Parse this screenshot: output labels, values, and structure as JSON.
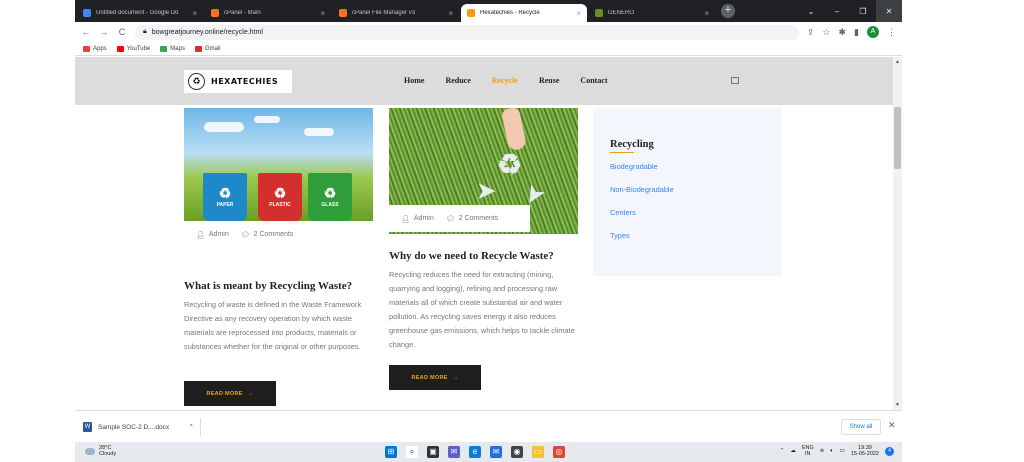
{
  "browser": {
    "tabs": [
      {
        "label": "Untitled document - Google Do",
        "favicon_color": "#4285f4",
        "active": false
      },
      {
        "label": "cPanel - Main",
        "favicon_color": "#ff6c2c",
        "active": false
      },
      {
        "label": "cPanel File Manager v3",
        "favicon_color": "#ff6c2c",
        "active": false
      },
      {
        "label": "Hexatechies - Recycle",
        "favicon_color": "#f39c12",
        "active": true
      },
      {
        "label": "GENERO",
        "favicon_color": "#6b8e23",
        "active": false
      }
    ],
    "new_tab_symbol": "+",
    "window_controls": {
      "chevron": "⌄",
      "minimize": "–",
      "maximize": "❐",
      "close": "✕"
    },
    "url": "bowgreatjourney.online/recycle.html",
    "nav": {
      "back": "←",
      "forward": "→",
      "reload": "C"
    },
    "profile_initial": "A",
    "bookmarks": [
      {
        "label": "Apps",
        "color": "#ea4335"
      },
      {
        "label": "YouTube",
        "color": "#ff0000"
      },
      {
        "label": "Maps",
        "color": "#34a853"
      },
      {
        "label": "Gmail",
        "color": "#d93025"
      }
    ]
  },
  "site": {
    "logo_text": "HEXATECHIES",
    "nav": [
      {
        "label": "Home",
        "active": false
      },
      {
        "label": "Reduce",
        "active": false
      },
      {
        "label": "Recycle",
        "active": true
      },
      {
        "label": "Reuse",
        "active": false
      },
      {
        "label": "Contact",
        "active": false
      }
    ],
    "posts": [
      {
        "author": "Admin",
        "comments": "2 Comments",
        "title": "What is meant by Recycling Waste?",
        "excerpt": "Recycling of waste is defined in the Waste Framework Directive as any recovery operation by which waste materials are reprocessed into products, materials or substances whether for the original or other purposes.",
        "read_more": "READ MORE",
        "bins": [
          {
            "label": "PAPER",
            "color": "#1e88c8"
          },
          {
            "label": "PLASTIC",
            "color": "#d32f2f"
          },
          {
            "label": "GLASS",
            "color": "#2e9d3a"
          }
        ]
      },
      {
        "author": "Admin",
        "comments": "2 Comments",
        "title": "Why do we need to Recycle Waste?",
        "excerpt": "Recycling reduces the need for extracting (mining, quarrying and logging), refining and processing raw materials all of which create substantial air and water pollution. As recycling saves energy it also reduces greenhouse gas emissions, which helps to tackle climate change.",
        "read_more": "READ MORE"
      }
    ],
    "sidebar": {
      "title": "Recycling",
      "links": [
        "Biodegradable",
        "Non-Biodegradable",
        "Centers",
        "Types"
      ]
    }
  },
  "downloads": {
    "file": "Sample SOC-2 D....docx",
    "show_all": "Show all"
  },
  "taskbar": {
    "temperature": "28°C",
    "weather": "Cloudy",
    "lang_top": "ENG",
    "lang_bottom": "IN",
    "time": "19:39",
    "date": "15-05-2022",
    "notif_count": "4"
  }
}
